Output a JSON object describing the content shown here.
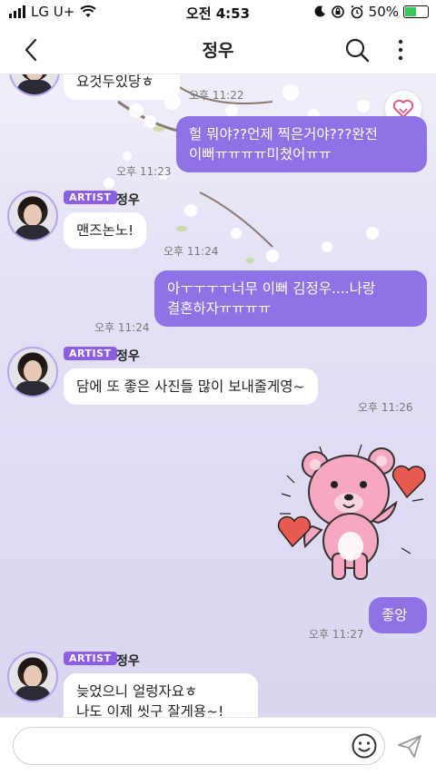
{
  "status_bar": {
    "carrier": "LG U+",
    "time": "오전 4:53",
    "battery": "50%"
  },
  "header": {
    "title": "정우",
    "icons": [
      "back-chevron-icon",
      "search-icon",
      "more-vert-icon"
    ]
  },
  "chat": {
    "messages": [
      {
        "side": "in",
        "text": "요것두있당ㅎ",
        "time": "오후 11:22"
      },
      {
        "side": "out",
        "text_line1": "헐 뭐야??언제 찍은거야???완전",
        "text_line2": "이뻐ㅠㅠㅠㅠ미쳤어ㅠㅠ",
        "time": "오후 11:23"
      },
      {
        "side": "in",
        "badge": "ARTIST",
        "sender": "정우",
        "text": "맨즈논노!",
        "time": "오후 11:24"
      },
      {
        "side": "out",
        "text_line1": "아ㅜㅜㅜㅜ너무 이뻐 김정우....나랑",
        "text_line2": "결혼하자ㅠㅠㅠㅠ",
        "time": "오후 11:24"
      },
      {
        "side": "in",
        "badge": "ARTIST",
        "sender": "정우",
        "text": "담에 또 좋은 사진들 많이 보내줄게영~",
        "time": "오후 11:26"
      },
      {
        "side": "out",
        "sticker": "pink-bear-hearts-sticker"
      },
      {
        "side": "out",
        "text": "좋앙",
        "time": "오후 11:27"
      },
      {
        "side": "in",
        "badge": "ARTIST",
        "sender": "정우",
        "text_line1": "늦었으니 얼렁자요ㅎ",
        "text_line2": "나도 이제 씻구 잘게용~!"
      }
    ]
  },
  "input": {
    "placeholder": "",
    "icons": [
      "emoji-icon",
      "send-icon"
    ]
  },
  "colors": {
    "accent": "#8e72e6",
    "badge": "#8c5ee6",
    "chat_bg": "#d9d6f0"
  }
}
